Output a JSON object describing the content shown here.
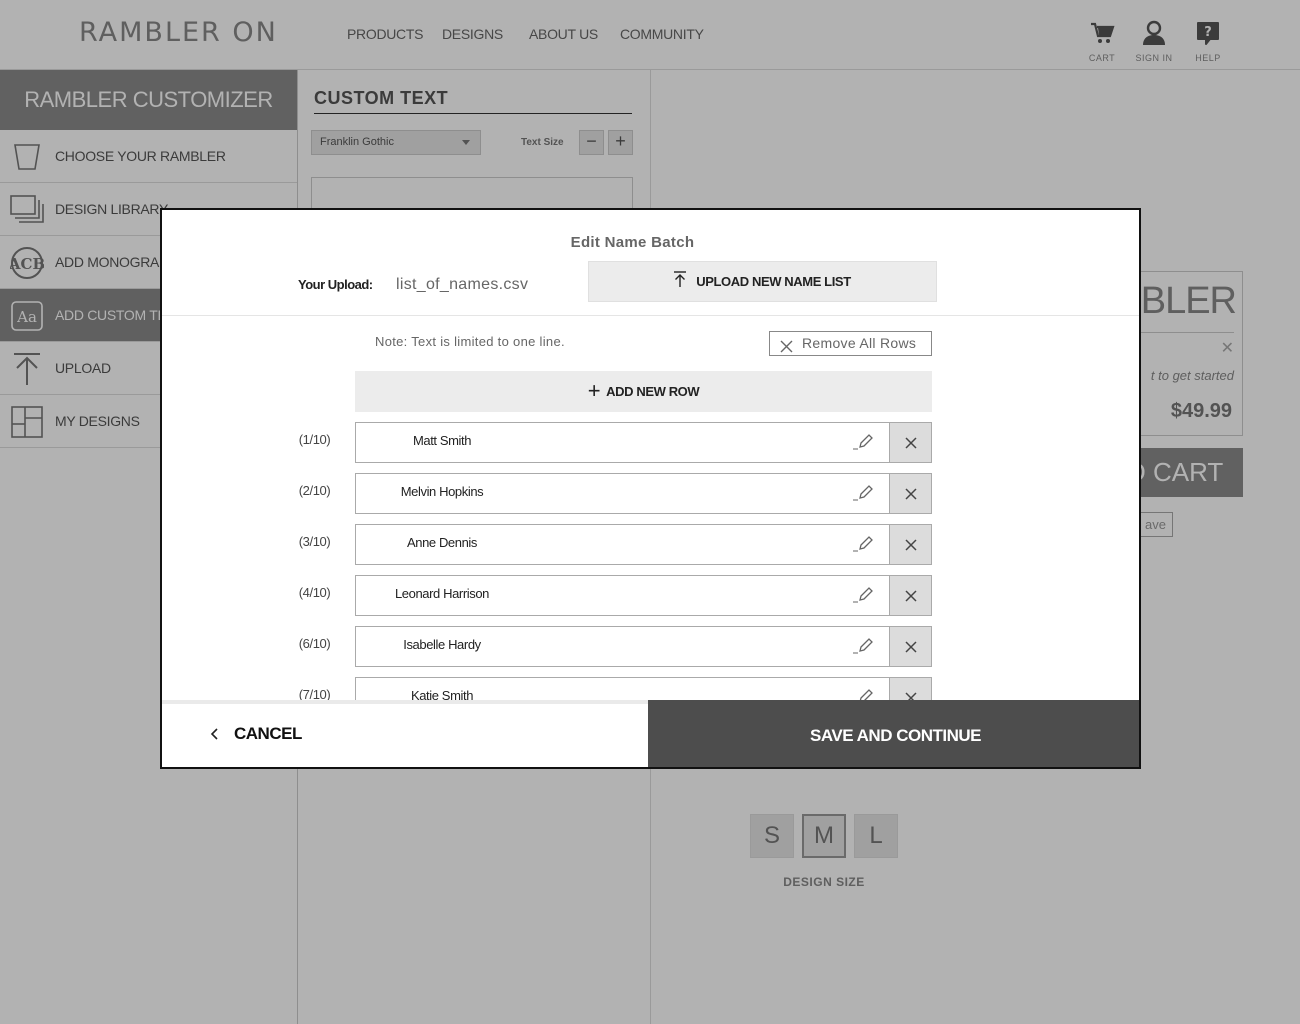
{
  "header": {
    "logo": "RAMBLER ON",
    "nav": [
      "PRODUCTS",
      "DESIGNS",
      "ABOUT US",
      "COMMUNITY"
    ],
    "icons": [
      {
        "label": "CART",
        "icon": "cart-icon"
      },
      {
        "label": "SIGN IN",
        "icon": "user-icon"
      },
      {
        "label": "HELP",
        "icon": "help-icon"
      }
    ]
  },
  "sidebar": {
    "title": "RAMBLER CUSTOMIZER",
    "items": [
      {
        "label": "CHOOSE YOUR RAMBLER",
        "icon": "cup-icon"
      },
      {
        "label": "DESIGN LIBRARY",
        "icon": "stack-icon"
      },
      {
        "label": "ADD MONOGRAMS",
        "icon": "monogram-icon"
      },
      {
        "label": "ADD CUSTOM TEXT",
        "icon": "text-icon"
      },
      {
        "label": "UPLOAD",
        "icon": "upload-icon"
      },
      {
        "label": "MY DESIGNS",
        "icon": "grid-icon"
      }
    ]
  },
  "text_panel": {
    "title": "CUSTOM TEXT",
    "font": "Franklin Gothic",
    "text_size_label": "Text Size",
    "minus": "−",
    "plus": "+"
  },
  "preview": {
    "card_name": "MBLER",
    "card_hint": "t to get started",
    "price": "$49.99",
    "add_to_cart": "D CART",
    "save": "ave",
    "sizes": [
      "S",
      "M",
      "L"
    ],
    "selected_size": "M",
    "design_size_label": "DESIGN SIZE"
  },
  "modal": {
    "title": "Edit Name Batch",
    "upload_label": "Your Upload:",
    "upload_file": "list_of_names.csv",
    "upload_button": "UPLOAD NEW NAME LIST",
    "note": "Note: Text is limited to one line.",
    "remove_all": "Remove All Rows",
    "add_row": "ADD NEW ROW",
    "rows": [
      {
        "index": "(1/10)",
        "name": "Matt Smith"
      },
      {
        "index": "(2/10)",
        "name": "Melvin Hopkins"
      },
      {
        "index": "(3/10)",
        "name": "Anne Dennis"
      },
      {
        "index": "(4/10)",
        "name": "Leonard Harrison"
      },
      {
        "index": "(6/10)",
        "name": "Isabelle Hardy"
      },
      {
        "index": "(7/10)",
        "name": "Katie Smith"
      }
    ],
    "cancel": "CANCEL",
    "save_continue": "SAVE AND CONTINUE"
  }
}
